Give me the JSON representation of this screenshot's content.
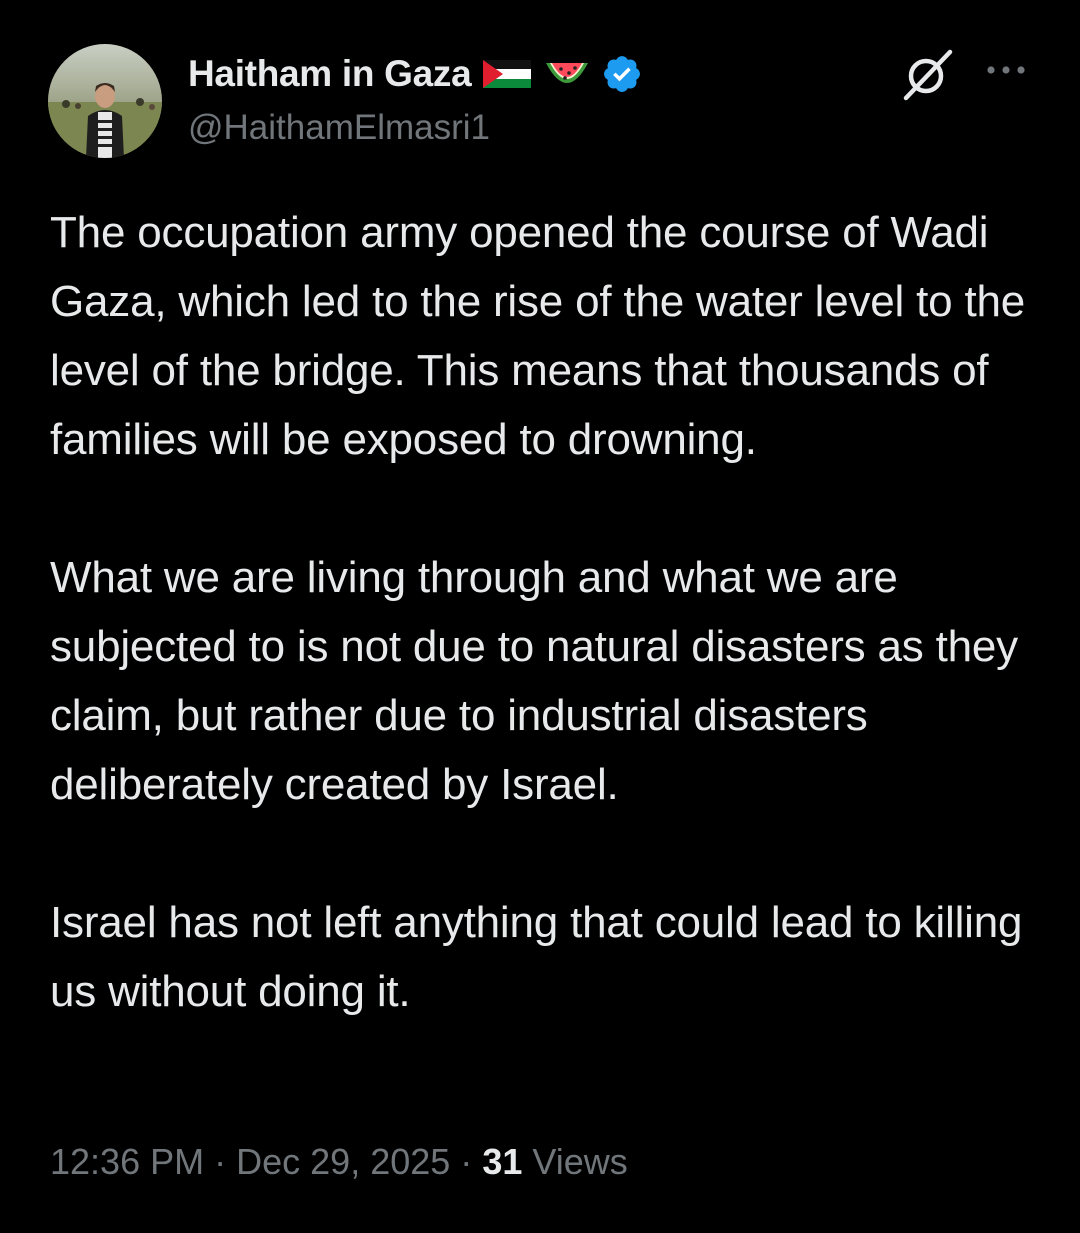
{
  "author": {
    "display_name": "Haitham in Gaza",
    "handle": "@HaithamElmasri1",
    "emojis": [
      "palestine-flag-emoji",
      "watermelon-emoji"
    ],
    "verified": true
  },
  "colors": {
    "background": "#000000",
    "text_primary": "#e7e9ea",
    "text_secondary": "#71767b",
    "verified_blue": "#1d9bf0"
  },
  "tweet": {
    "paragraphs": [
      "The occupation army opened the course of Wadi Gaza, which led to the rise of the water level to the level of the bridge. This means that thousands of families will be exposed to drowning.",
      "What we are living through and what we are subjected to is not due to natural disasters as they claim, but rather due to industrial disasters deliberately created by Israel.",
      "Israel has not left anything that could lead to killing us without doing it."
    ],
    "time": "12:36 PM",
    "date": "Dec 29, 2025",
    "separator": "·",
    "views_count": "31",
    "views_label": "Views"
  },
  "icons": {
    "grok": "grok-icon",
    "more": "more-dots-icon",
    "verified": "verified-badge-icon"
  }
}
